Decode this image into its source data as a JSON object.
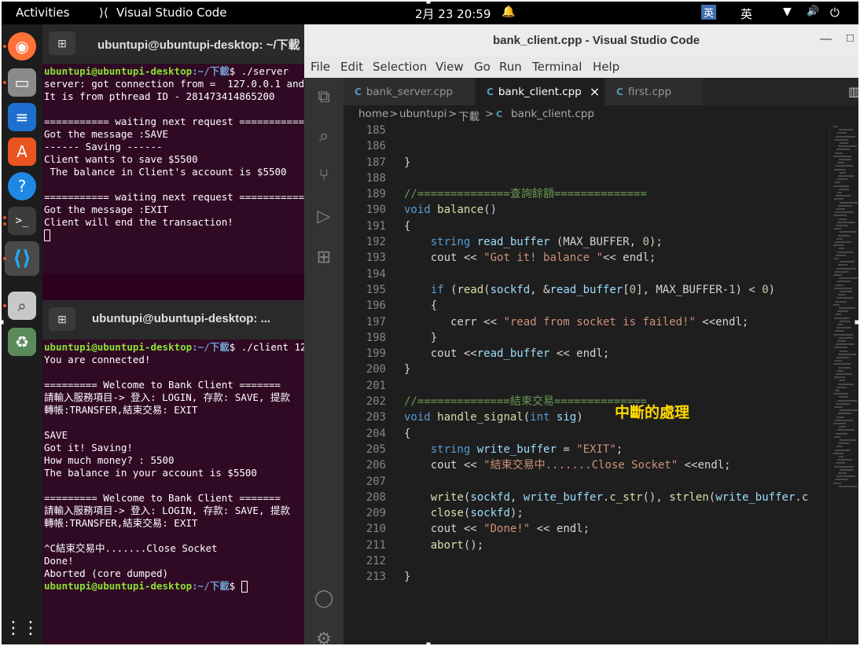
{
  "topbar": {
    "activities": "Activities",
    "app_name": "Visual Studio Code",
    "datetime": "2月 23  20:59",
    "bell": "🔔",
    "ime_badge": "英",
    "ime_label": "英",
    "network": "▼",
    "volume": "🔊",
    "power": "⏻"
  },
  "dock": {
    "items": [
      "firefox-icon",
      "files-icon",
      "writer-icon",
      "software-icon",
      "help-icon",
      "terminal-icon",
      "vscode-icon",
      "screenshot-icon",
      "trash-icon",
      "app-grid-icon"
    ],
    "accent": "#e95420"
  },
  "term1": {
    "title": "ubuntupi@ubuntupi-desktop: ~/下載",
    "prompt_user": "ubuntupi@ubuntupi-desktop",
    "prompt_path": ":~/下載",
    "command": "$ ./server",
    "lines": [
      "server: got connection from =  127.0.0.1 and",
      "It is from pthread ID - 281473414865200",
      "",
      "=========== waiting next request ============",
      "Got the message :SAVE",
      "------ Saving ------",
      "Client wants to save $5500",
      " The balance in Client's account is $5500",
      "",
      "=========== waiting next request ============",
      "Got the message :EXIT",
      "Client will end the transaction!"
    ]
  },
  "term2": {
    "title": "ubuntupi@ubuntupi-desktop: ...",
    "prompt_user": "ubuntupi@ubuntupi-desktop",
    "prompt_path": ":~/下載",
    "command": "$ ./client 12",
    "lines": [
      "You are connected!",
      "",
      "========= Welcome to Bank Client =======",
      "請輸入服務項目-> 登入: LOGIN, 存款: SAVE, 提款",
      "轉帳:TRANSFER,結束交易: EXIT",
      "",
      "SAVE",
      "Got it! Saving!",
      "How much money? : 5500",
      "The balance in your account is $5500",
      "",
      "========= Welcome to Bank Client =======",
      "請輸入服務項目-> 登入: LOGIN, 存款: SAVE, 提款",
      "轉帳:TRANSFER,結束交易: EXIT",
      "",
      "^C結束交易中.......Close Socket",
      "Done!",
      "Aborted (core dumped)"
    ],
    "final_prompt": "$ "
  },
  "vscode": {
    "title": "bank_client.cpp - Visual Studio Code",
    "minimize": "—",
    "maximize": "□",
    "menu": [
      "File",
      "Edit",
      "Selection",
      "View",
      "Go",
      "Run",
      "Terminal",
      "Help"
    ],
    "tabs": [
      {
        "label": "bank_server.cpp",
        "active": false
      },
      {
        "label": "bank_client.cpp",
        "active": true
      },
      {
        "label": "first.cpp",
        "active": false
      }
    ],
    "tab_close": "×",
    "tab_icon": "C",
    "split_icon": "▥",
    "breadcrumb": [
      "home",
      "ubuntupi",
      "下載",
      "bank_client.cpp"
    ],
    "breadcrumb_sep": ">",
    "line_numbers": [
      "185",
      "186",
      "187",
      "188",
      "189",
      "190",
      "191",
      "192",
      "193",
      "194",
      "195",
      "196",
      "197",
      "198",
      "199",
      "200",
      "201",
      "202",
      "203",
      "204",
      "205",
      "206",
      "207",
      "208",
      "209",
      "210",
      "211",
      "212",
      "213"
    ],
    "code_lines": [
      "",
      "",
      "}",
      "",
      "//==============查詢餘額==============",
      "void balance()",
      "{",
      "    string read_buffer (MAX_BUFFER, 0);",
      "    cout << \"Got it! balance \"<< endl;",
      "",
      "    if (read(sockfd, &read_buffer[0], MAX_BUFFER-1) < 0)",
      "    {",
      "       cerr << \"read from socket is failed!\" <<endl;",
      "    }",
      "    cout <<read_buffer << endl;",
      "}",
      "",
      "//==============結束交易==============",
      "void handle_signal(int sig)",
      "{",
      "    string write_buffer = \"EXIT\";",
      "    cout << \"結束交易中.......Close Socket\" <<endl;",
      "",
      "    write(sockfd, write_buffer.c_str(), strlen(write_buffer.c",
      "    close(sockfd);",
      "    cout << \"Done!\" << endl;",
      "    abort();",
      "",
      "}"
    ],
    "annotation": "中斷的處理"
  },
  "colors": {
    "terminal_bg": "#300a24",
    "editor_bg": "#1e1e1e",
    "keyword": "#569cd6",
    "function": "#dcdcaa",
    "string": "#ce9178",
    "comment": "#6a9955",
    "annotation": "#ffd700"
  }
}
